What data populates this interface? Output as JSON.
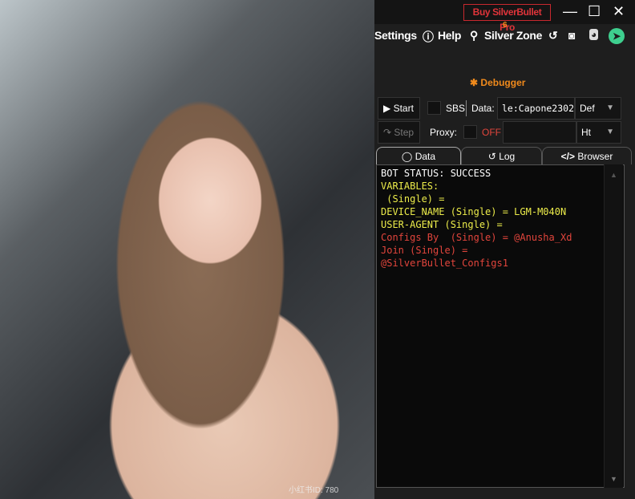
{
  "photo": {
    "watermark": "小红书ID: 780"
  },
  "titlebar": {
    "buy_label": "Buy SilverBullet Pro",
    "minimize": "—",
    "maximize": "☐",
    "close": "✕"
  },
  "menu": {
    "settings": "Settings",
    "help": "Help",
    "silver_zone": "Silver Zone",
    "badge": "6"
  },
  "debugger": {
    "title": "Debugger"
  },
  "controls": {
    "start": "Start",
    "sbs": "SBS",
    "data_label": "Data:",
    "data_value": "le:Capone2302",
    "data_type": "Def",
    "step": "Step",
    "proxy_label": "Proxy:",
    "proxy_state": "OFF",
    "proxy_value": "",
    "proxy_type": "Ht"
  },
  "tabs": [
    {
      "label": "Data"
    },
    {
      "label": "Log"
    },
    {
      "label": "Browser"
    }
  ],
  "console": {
    "lines": [
      {
        "text": "BOT STATUS: SUCCESS",
        "color": "#ffffff"
      },
      {
        "text": "VARIABLES:",
        "color": "#ecec4a"
      },
      {
        "text": " (Single) =",
        "color": "#ecec4a"
      },
      {
        "text": "DEVICE_NAME (Single) = LGM-M040N",
        "color": "#ecec4a"
      },
      {
        "text": "USER-AGENT (Single) =",
        "color": "#ecec4a"
      },
      {
        "text": "Configs By  (Single) = @Anusha_Xd",
        "color": "#e2453c"
      },
      {
        "text": "Join (Single) =",
        "color": "#e2453c"
      },
      {
        "text": "@SilverBullet_Configs1",
        "color": "#e2453c"
      }
    ]
  },
  "colors": {
    "accent": "#f08a1c",
    "danger": "#e2453c",
    "telegram": "#3ecf8e"
  }
}
